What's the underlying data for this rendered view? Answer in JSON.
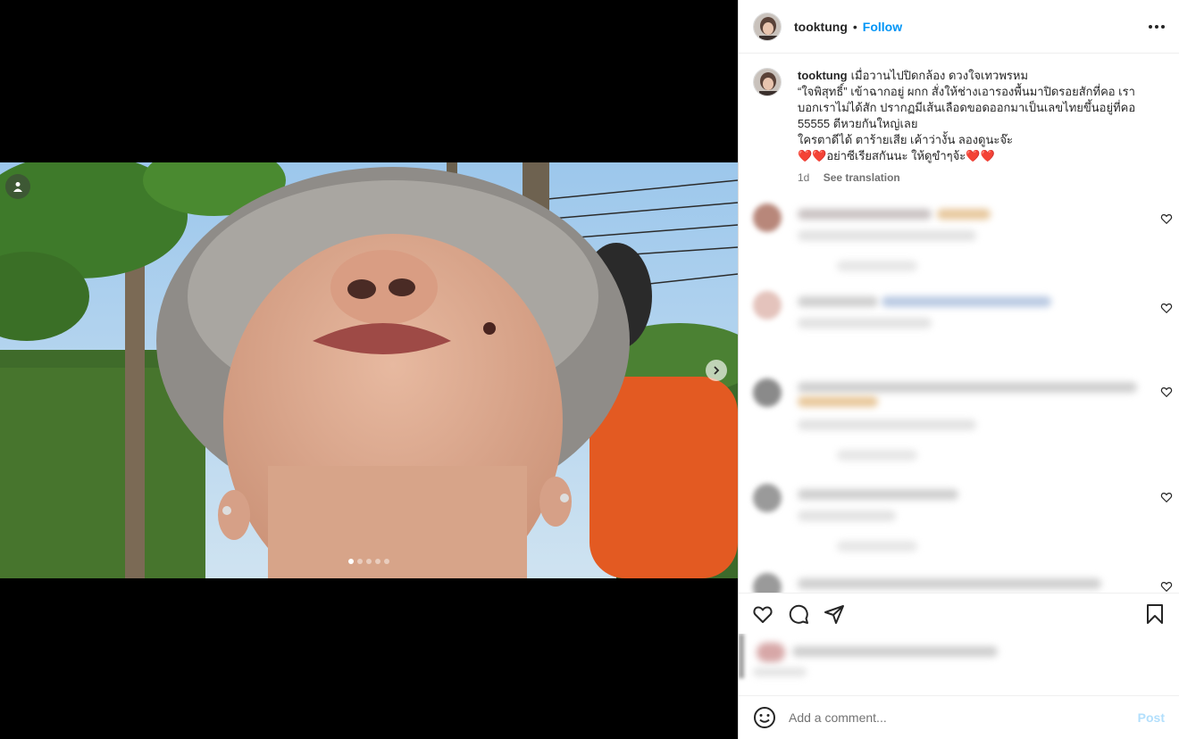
{
  "colors": {
    "accent": "#0095f6",
    "post_disabled": "#b2dffc",
    "heart": "#e0103a",
    "text": "#262626",
    "secondary_text": "#737373"
  },
  "header": {
    "username": "tooktung",
    "separator": "•",
    "follow_label": "Follow",
    "more_icon": "more-horizontal-icon"
  },
  "media": {
    "carousel_count": 5,
    "current_index": 0
  },
  "caption": {
    "username": "tooktung",
    "lines": [
      "เมื่อวานไปปิดกล้อง ดวงใจเทวพรหม",
      "“ใจพิสุทธิ์” เข้าฉากอยู่ ผกก สั่งให้ช่างเอารองพื้นมาปิดรอยสักที่คอ เรา",
      "บอกเราไม่ได้สัก ปรากฏมีเส้นเลือดขอดออกมาเป็นเลขไทยขึ้นอยู่ที่คอ",
      "55555 ตีหวยกันใหญ่เลย",
      "ใครตาดีได้ ตาร้ายเสีย เค้าว่างั้น ลองดูนะจ๊ะ"
    ],
    "last_line_hearts_before": "❤️❤️",
    "last_line_text": "อย่าซีเรียสกันนะ ให้ดูขำๆจ้ะ",
    "last_line_hearts_after": "❤️❤️",
    "time": "1d",
    "see_translation": "See translation"
  },
  "actions": {
    "like_icon": "heart-outline-icon",
    "comment_icon": "comment-bubble-icon",
    "share_icon": "send-paper-plane-icon",
    "save_icon": "bookmark-icon"
  },
  "add_comment": {
    "emoji_icon": "emoji-smile-icon",
    "placeholder": "Add a comment...",
    "post_label": "Post"
  }
}
